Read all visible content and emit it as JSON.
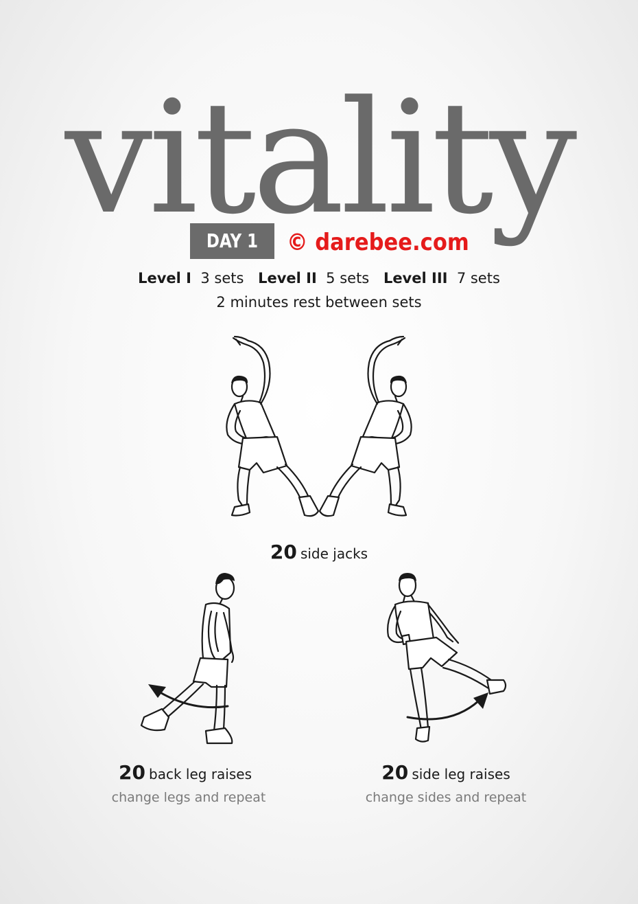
{
  "header": {
    "title": "vitality",
    "day_label": "DAY 1",
    "brand": "© darebee.com",
    "brand_color": "#e51b1b"
  },
  "levels": [
    {
      "label": "Level I",
      "sets": "3 sets"
    },
    {
      "label": "Level II",
      "sets": "5 sets"
    },
    {
      "label": "Level III",
      "sets": "7 sets"
    }
  ],
  "rest": "2 minutes rest between sets",
  "exercises": [
    {
      "count": "20",
      "name": "side jacks",
      "note": "",
      "icon": "side-jacks-figure"
    },
    {
      "count": "20",
      "name": "back leg raises",
      "note": "change legs and repeat",
      "icon": "back-leg-raise-figure"
    },
    {
      "count": "20",
      "name": "side leg raises",
      "note": "change sides and repeat",
      "icon": "side-leg-raise-figure"
    }
  ]
}
